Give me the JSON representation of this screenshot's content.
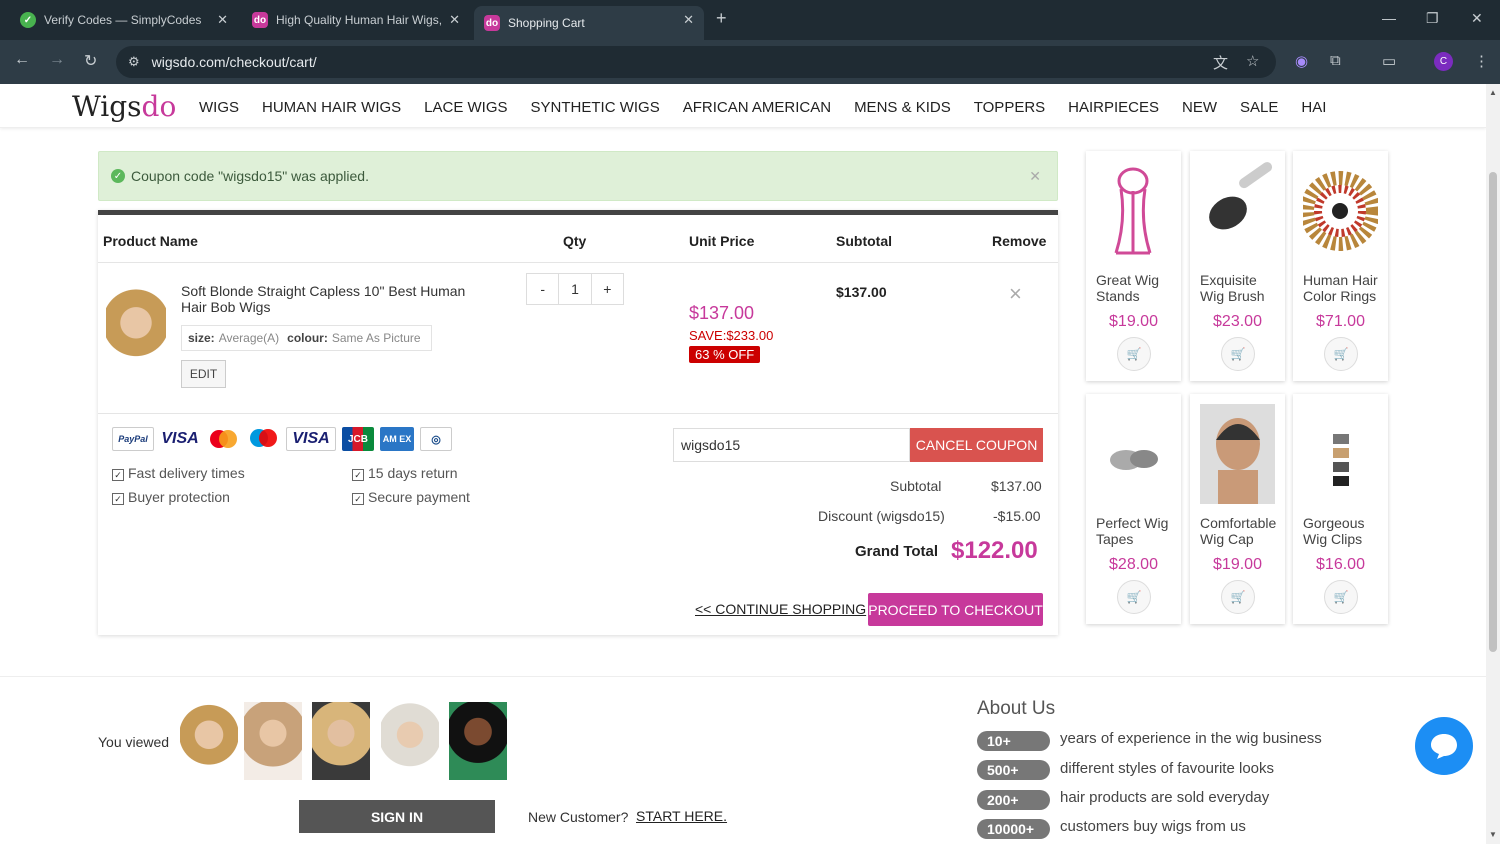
{
  "browser": {
    "tabs": [
      {
        "title": "Verify Codes — SimplyCodes"
      },
      {
        "title": "High Quality Human Hair Wigs,"
      },
      {
        "title": "Shopping Cart"
      }
    ],
    "url": "wigsdo.com/checkout/cart/",
    "profile_initial": "C"
  },
  "site": {
    "logo_a": "Wigs",
    "logo_b": "do",
    "menu": [
      "WIGS",
      "HUMAN HAIR WIGS",
      "LACE WIGS",
      "SYNTHETIC WIGS",
      "AFRICAN AMERICAN",
      "MENS & KIDS",
      "TOPPERS",
      "HAIRPIECES",
      "NEW",
      "SALE",
      "HAI"
    ],
    "accent_color": "#c7399b"
  },
  "alert": {
    "text": "Coupon code \"wigsdo15\" was applied."
  },
  "cart": {
    "headers": {
      "product": "Product Name",
      "qty": "Qty",
      "unit_price": "Unit Price",
      "subtotal": "Subtotal",
      "remove": "Remove"
    },
    "item": {
      "name": "Soft Blonde Straight Capless 10\" Best Human Hair Bob Wigs",
      "size_label": "size:",
      "size": "Average(A)",
      "colour_label": "colour:",
      "colour": "Same As Picture",
      "edit": "EDIT",
      "qty_minus": "-",
      "qty": "1",
      "qty_plus": "+",
      "price": "$137.00",
      "save": "SAVE:$233.00",
      "off": "63 % OFF",
      "subtotal": "$137.00",
      "remove_icon": "×"
    },
    "features": [
      "Fast delivery times",
      "15 days return",
      "Buyer protection",
      "Secure payment"
    ],
    "coupon_value": "wigsdo15",
    "cancel_coupon": "CANCEL COUPON",
    "totals": {
      "subtotal_label": "Subtotal",
      "subtotal": "$137.00",
      "discount_label": "Discount (wigsdo15)",
      "discount": "-$15.00",
      "grand_label": "Grand Total",
      "grand": "$122.00"
    },
    "continue": "<< CONTINUE SHOPPING",
    "checkout": "PROCEED TO CHECKOUT"
  },
  "recommended": [
    {
      "name": "Great Wig Stands",
      "price": "$19.00"
    },
    {
      "name": "Exquisite Wig Brush",
      "price": "$23.00"
    },
    {
      "name": "Human Hair Color Rings",
      "price": "$71.00"
    },
    {
      "name": "Perfect Wig Tapes",
      "price": "$28.00"
    },
    {
      "name": "Comfortable Wig Cap",
      "price": "$19.00"
    },
    {
      "name": "Gorgeous Wig Clips",
      "price": "$16.00"
    }
  ],
  "footer": {
    "you_viewed": "You viewed",
    "sign_in": "SIGN IN",
    "new_customer": "New Customer?",
    "start_here": "START HERE.",
    "about_title": "About Us",
    "stats": [
      {
        "num": "10+",
        "text": "years of experience in the wig business"
      },
      {
        "num": "500+",
        "text": "different styles of favourite looks"
      },
      {
        "num": "200+",
        "text": "hair products are sold everyday"
      },
      {
        "num": "10000+",
        "text": "customers buy wigs from us"
      }
    ]
  }
}
